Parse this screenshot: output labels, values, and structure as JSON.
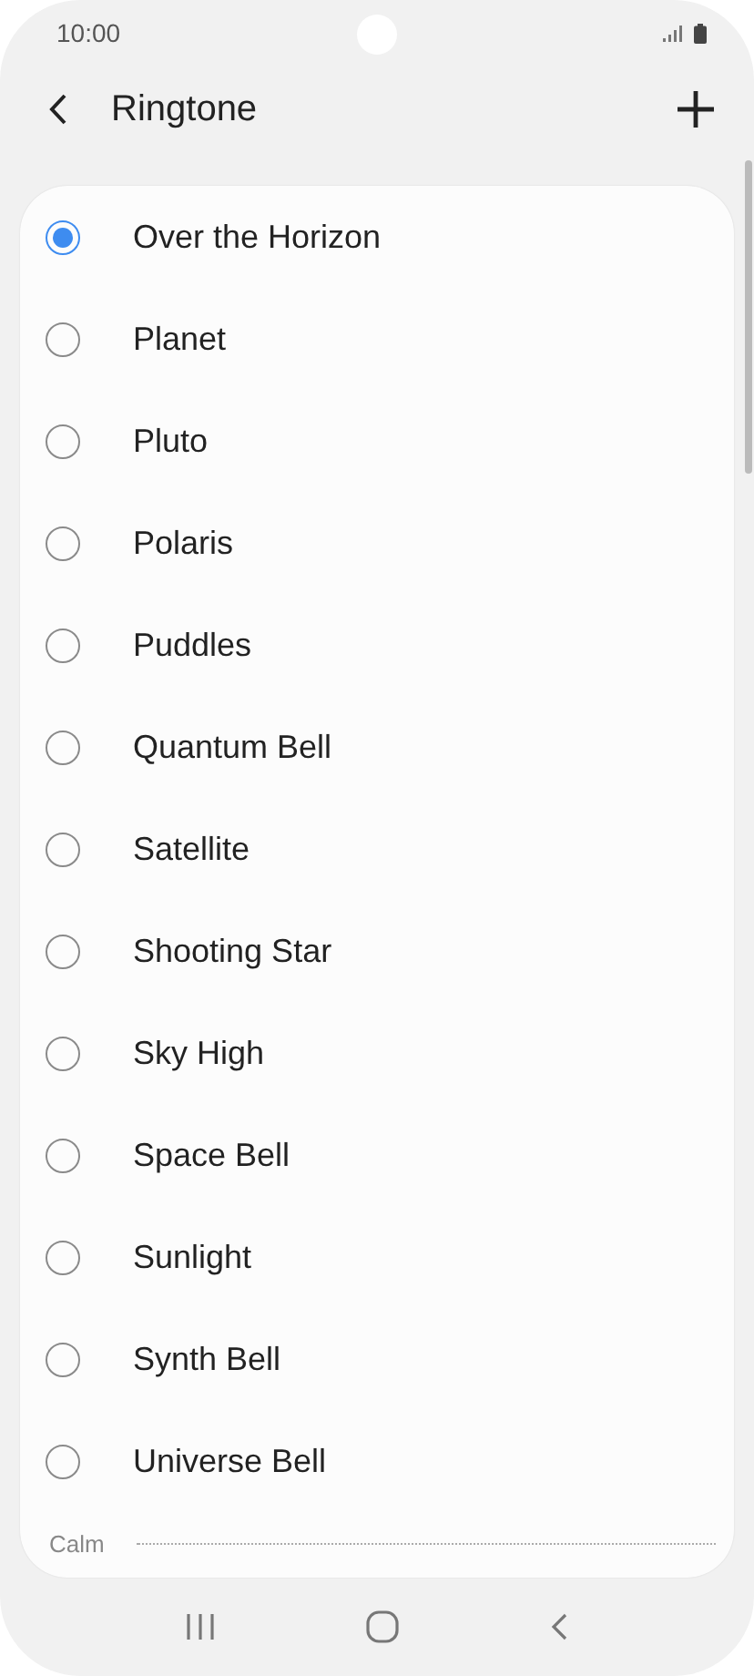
{
  "status_bar": {
    "time": "10:00"
  },
  "header": {
    "title": "Ringtone"
  },
  "ringtones": [
    {
      "label": "Over the Horizon",
      "selected": true
    },
    {
      "label": "Planet",
      "selected": false
    },
    {
      "label": "Pluto",
      "selected": false
    },
    {
      "label": "Polaris",
      "selected": false
    },
    {
      "label": "Puddles",
      "selected": false
    },
    {
      "label": "Quantum Bell",
      "selected": false
    },
    {
      "label": "Satellite",
      "selected": false
    },
    {
      "label": "Shooting Star",
      "selected": false
    },
    {
      "label": "Sky High",
      "selected": false
    },
    {
      "label": "Space Bell",
      "selected": false
    },
    {
      "label": "Sunlight",
      "selected": false
    },
    {
      "label": "Synth Bell",
      "selected": false
    },
    {
      "label": "Universe Bell",
      "selected": false
    }
  ],
  "section": {
    "label": "Calm"
  }
}
